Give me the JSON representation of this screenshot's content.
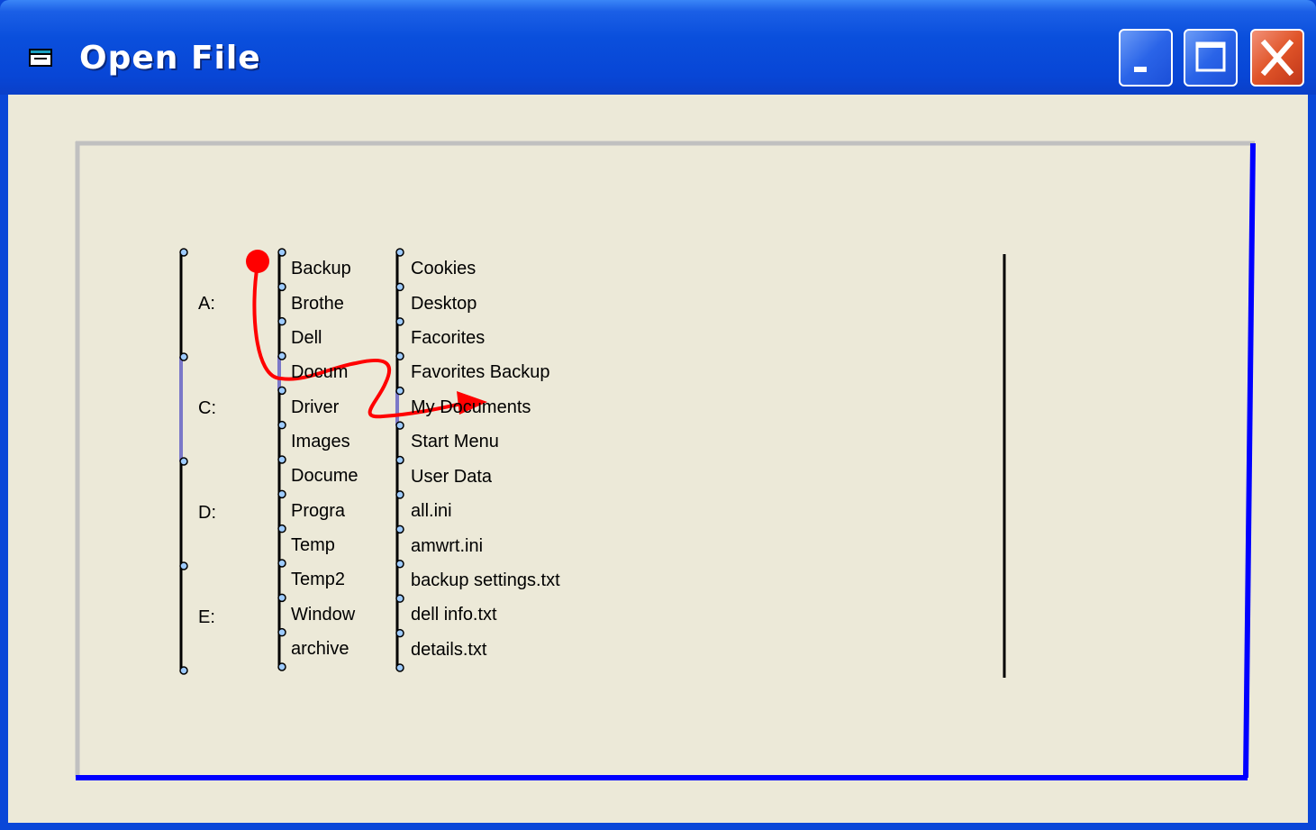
{
  "window": {
    "title": "Open File"
  },
  "drives": [
    "A:",
    "C:",
    "D:",
    "E:"
  ],
  "folders": [
    "Backup",
    "Brothe",
    "Dell",
    "Docum",
    "Driver",
    "Images",
    "Docume",
    "Progra",
    "Temp",
    "Temp2",
    "Window",
    "archive"
  ],
  "files": [
    "Cookies",
    "Desktop",
    "Facorites",
    "Favorites Backup",
    "My Documents",
    "Start Menu",
    "User Data",
    "all.ini",
    "amwrt.ini",
    "backup settings.txt",
    "dell info.txt",
    "details.txt"
  ],
  "selection": {
    "drive": "C:",
    "folder": "Docum",
    "file": "My Documents"
  },
  "colors": {
    "title_bar": "#0a4fdc",
    "client_bg": "#ece9d8",
    "highlight": "#7b78c8",
    "gesture": "#ff0000",
    "canvas_border": "#0000ff"
  }
}
